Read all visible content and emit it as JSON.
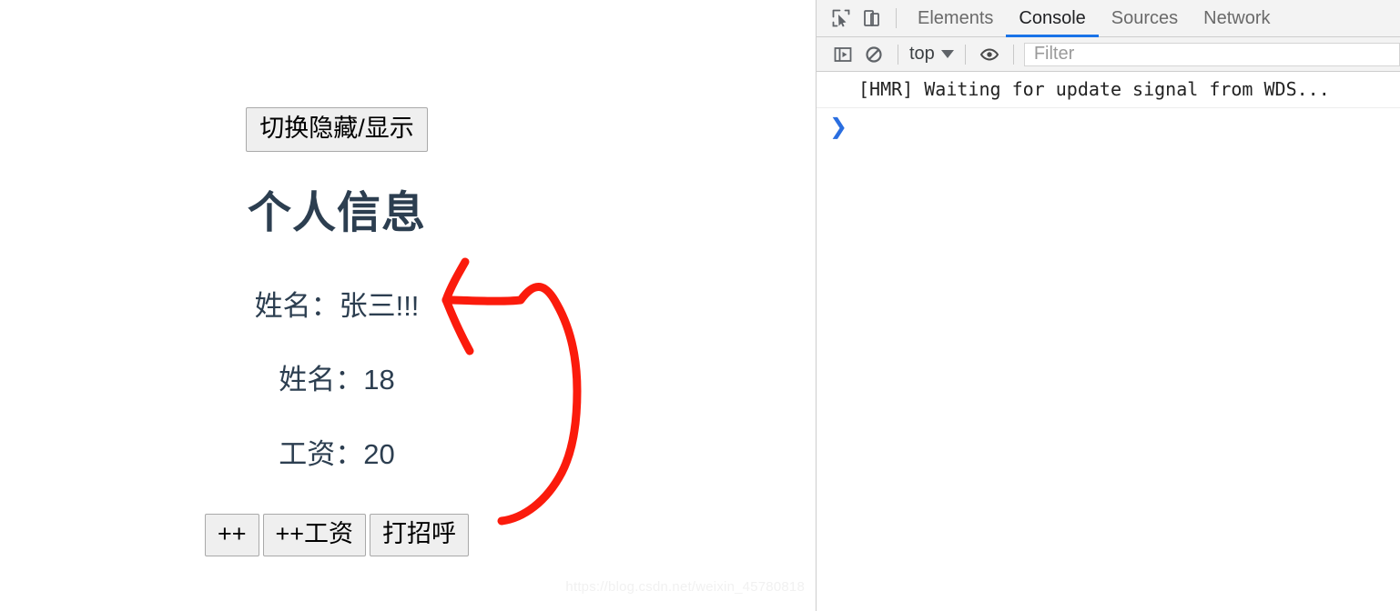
{
  "page": {
    "toggle_button_label": "切换隐藏/显示",
    "heading": "个人信息",
    "info": {
      "name_line": "姓名：张三!!!",
      "age_line": "姓名：18",
      "salary_line": "工资：20"
    },
    "buttons": {
      "increment": "++",
      "increment_salary": "++工资",
      "greet": "打招呼"
    },
    "annotation": {
      "color": "#fb1b0c",
      "shape": "hand-drawn-curved-arrow"
    },
    "watermark": "https://blog.csdn.net/weixin_45780818"
  },
  "devtools": {
    "tabs": [
      {
        "label": "Elements",
        "active": false
      },
      {
        "label": "Console",
        "active": true
      },
      {
        "label": "Sources",
        "active": false
      },
      {
        "label": "Network",
        "active": false
      }
    ],
    "active_tab_accent": "#1a73e8",
    "toolbar": {
      "context_selector": "top",
      "filter_placeholder": "Filter"
    },
    "console": {
      "messages": [
        "[HMR] Waiting for update signal from WDS..."
      ],
      "prompt_symbol": "❯"
    }
  }
}
